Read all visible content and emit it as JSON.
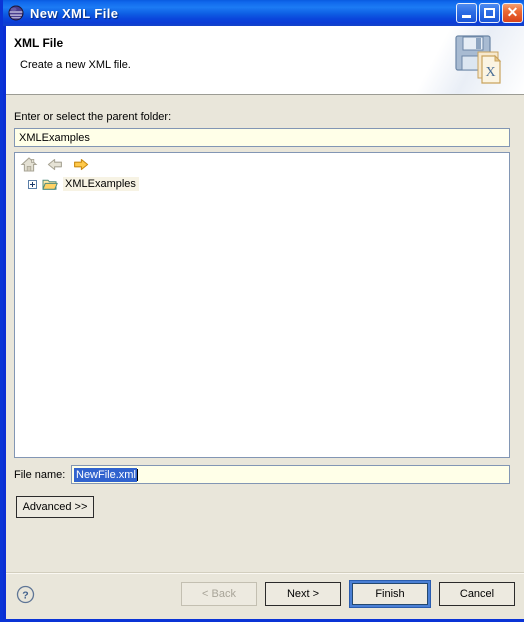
{
  "window": {
    "title": "New XML File",
    "icon": "eclipse-globe-icon",
    "controls": {
      "minimize": "minimize-button",
      "maximize": "maximize-button",
      "close_glyph": "✕"
    }
  },
  "header": {
    "title": "XML File",
    "description": "Create a new XML file.",
    "icon": "xml-file-wizard-icon"
  },
  "form": {
    "parent_folder_label": "Enter or select the parent folder:",
    "parent_folder_value": "XMLExamples",
    "file_name_label": "File name:",
    "file_name_value": "NewFile.xml",
    "advanced_label": "Advanced >>"
  },
  "tree": {
    "toolbar": {
      "home": "home-icon",
      "back": "back-arrow-icon",
      "forward": "forward-arrow-icon"
    },
    "items": [
      {
        "label": "XMLExamples",
        "expanded": false,
        "selected": true
      }
    ]
  },
  "footer": {
    "help": "?",
    "back_label": "< Back",
    "next_label": "Next >",
    "finish_label": "Finish",
    "cancel_label": "Cancel"
  },
  "colors": {
    "titlebar_blue": "#1068EC",
    "body_beige": "#E9E6DA",
    "input_yellow": "#FFFFE8",
    "selection_blue": "#3163CE",
    "close_red": "#D8431A",
    "default_button_blue": "#4A7FD4"
  }
}
